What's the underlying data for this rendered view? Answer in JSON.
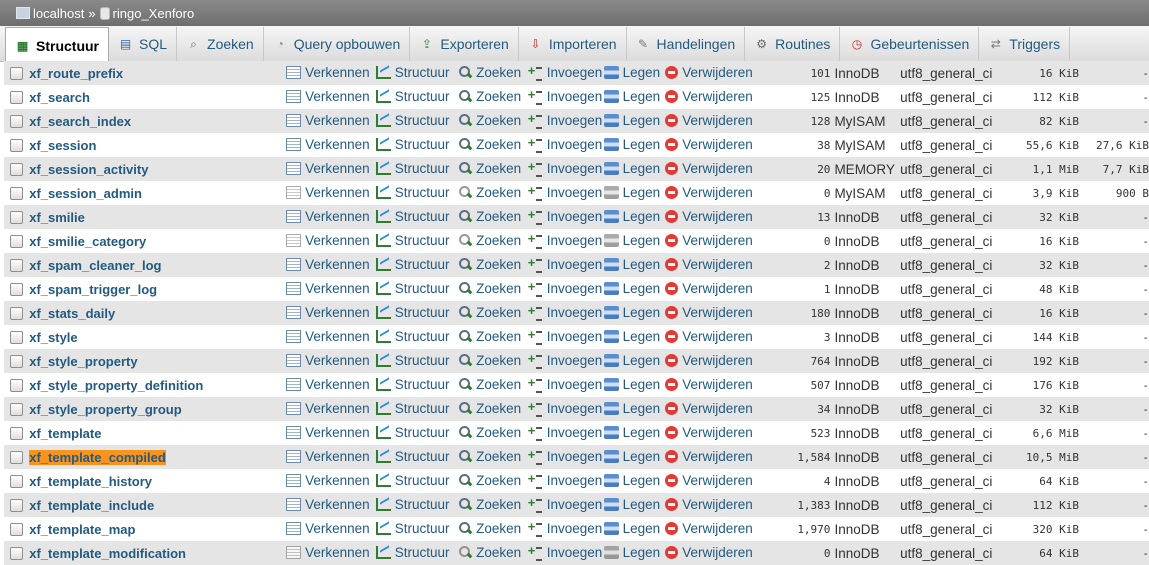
{
  "breadcrumb": {
    "server": "localhost",
    "separator": "»",
    "database": "ringo_Xenforo"
  },
  "tabs": [
    {
      "label": "Structuur",
      "icon": "structure-icon",
      "active": true
    },
    {
      "label": "SQL",
      "icon": "sql-icon"
    },
    {
      "label": "Zoeken",
      "icon": "search-icon"
    },
    {
      "label": "Query opbouwen",
      "icon": "query-icon"
    },
    {
      "label": "Exporteren",
      "icon": "export-icon"
    },
    {
      "label": "Importeren",
      "icon": "import-icon"
    },
    {
      "label": "Handelingen",
      "icon": "wrench-icon"
    },
    {
      "label": "Routines",
      "icon": "routines-icon"
    },
    {
      "label": "Gebeurtenissen",
      "icon": "clock-icon"
    },
    {
      "label": "Triggers",
      "icon": "triggers-icon"
    }
  ],
  "actions": {
    "browse": "Verkennen",
    "structure": "Structuur",
    "search": "Zoeken",
    "insert": "Invoegen",
    "empty": "Legen",
    "drop": "Verwijderen"
  },
  "rows": [
    {
      "name": "xf_route_prefix",
      "rows": "101",
      "type": "InnoDB",
      "collation": "utf8_general_ci",
      "size": "16 KiB",
      "overhead": "-"
    },
    {
      "name": "xf_search",
      "rows": "125",
      "type": "InnoDB",
      "collation": "utf8_general_ci",
      "size": "112 KiB",
      "overhead": "-"
    },
    {
      "name": "xf_search_index",
      "rows": "128",
      "type": "MyISAM",
      "collation": "utf8_general_ci",
      "size": "82 KiB",
      "overhead": "-"
    },
    {
      "name": "xf_session",
      "rows": "38",
      "type": "MyISAM",
      "collation": "utf8_general_ci",
      "size": "55,6 KiB",
      "overhead": "27,6 KiB"
    },
    {
      "name": "xf_session_activity",
      "rows": "20",
      "type": "MEMORY",
      "collation": "utf8_general_ci",
      "size": "1,1 MiB",
      "overhead": "7,7 KiB"
    },
    {
      "name": "xf_session_admin",
      "rows": "0",
      "type": "MyISAM",
      "collation": "utf8_general_ci",
      "size": "3,9 KiB",
      "overhead": "900 B",
      "dim": true
    },
    {
      "name": "xf_smilie",
      "rows": "13",
      "type": "InnoDB",
      "collation": "utf8_general_ci",
      "size": "32 KiB",
      "overhead": "-"
    },
    {
      "name": "xf_smilie_category",
      "rows": "0",
      "type": "InnoDB",
      "collation": "utf8_general_ci",
      "size": "16 KiB",
      "overhead": "-",
      "dim": true
    },
    {
      "name": "xf_spam_cleaner_log",
      "rows": "2",
      "type": "InnoDB",
      "collation": "utf8_general_ci",
      "size": "32 KiB",
      "overhead": "-"
    },
    {
      "name": "xf_spam_trigger_log",
      "rows": "1",
      "type": "InnoDB",
      "collation": "utf8_general_ci",
      "size": "48 KiB",
      "overhead": "-"
    },
    {
      "name": "xf_stats_daily",
      "rows": "180",
      "type": "InnoDB",
      "collation": "utf8_general_ci",
      "size": "16 KiB",
      "overhead": "-"
    },
    {
      "name": "xf_style",
      "rows": "3",
      "type": "InnoDB",
      "collation": "utf8_general_ci",
      "size": "144 KiB",
      "overhead": "-"
    },
    {
      "name": "xf_style_property",
      "rows": "764",
      "type": "InnoDB",
      "collation": "utf8_general_ci",
      "size": "192 KiB",
      "overhead": "-"
    },
    {
      "name": "xf_style_property_definition",
      "rows": "507",
      "type": "InnoDB",
      "collation": "utf8_general_ci",
      "size": "176 KiB",
      "overhead": "-"
    },
    {
      "name": "xf_style_property_group",
      "rows": "34",
      "type": "InnoDB",
      "collation": "utf8_general_ci",
      "size": "32 KiB",
      "overhead": "-"
    },
    {
      "name": "xf_template",
      "rows": "523",
      "type": "InnoDB",
      "collation": "utf8_general_ci",
      "size": "6,6 MiB",
      "overhead": "-"
    },
    {
      "name": "xf_template_compiled",
      "rows": "1,584",
      "type": "InnoDB",
      "collation": "utf8_general_ci",
      "size": "10,5 MiB",
      "overhead": "-",
      "highlight": true
    },
    {
      "name": "xf_template_history",
      "rows": "4",
      "type": "InnoDB",
      "collation": "utf8_general_ci",
      "size": "64 KiB",
      "overhead": "-"
    },
    {
      "name": "xf_template_include",
      "rows": "1,383",
      "type": "InnoDB",
      "collation": "utf8_general_ci",
      "size": "112 KiB",
      "overhead": "-"
    },
    {
      "name": "xf_template_map",
      "rows": "1,970",
      "type": "InnoDB",
      "collation": "utf8_general_ci",
      "size": "320 KiB",
      "overhead": "-"
    },
    {
      "name": "xf_template_modification",
      "rows": "0",
      "type": "InnoDB",
      "collation": "utf8_general_ci",
      "size": "64 KiB",
      "overhead": "-",
      "dim": true
    }
  ]
}
